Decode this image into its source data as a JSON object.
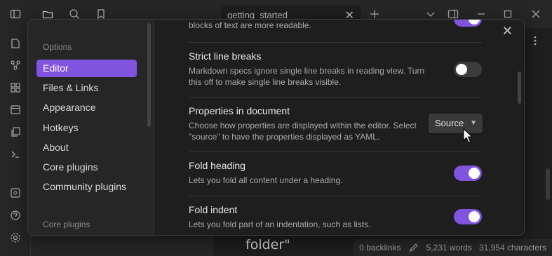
{
  "tab": {
    "title": "getting_started",
    "close": "✕"
  },
  "background": {
    "folder_text": "folder\""
  },
  "status": {
    "backlinks": "0 backlinks",
    "words": "5,231 words",
    "characters": "31,954 characters"
  },
  "modal": {
    "close": "✕",
    "sidebar": {
      "options_heading": "Options",
      "items": [
        {
          "label": "Editor",
          "active": true
        },
        {
          "label": "Files & Links"
        },
        {
          "label": "Appearance"
        },
        {
          "label": "Hotkeys"
        },
        {
          "label": "About"
        },
        {
          "label": "Core plugins"
        },
        {
          "label": "Community plugins"
        }
      ],
      "core_plugins_heading": "Core plugins"
    },
    "settings": {
      "top_desc": "blocks of text are more readable.",
      "strict": {
        "name": "Strict line breaks",
        "desc": "Markdown specs ignore single line breaks in reading view. Turn this off to make single line breaks visible.",
        "toggle": false
      },
      "properties": {
        "name": "Properties in document",
        "desc": "Choose how properties are displayed within the editor. Select \"source\" to have the properties displayed as YAML.",
        "value": "Source"
      },
      "fold_heading": {
        "name": "Fold heading",
        "desc": "Lets you fold all content under a heading.",
        "toggle": true
      },
      "fold_indent": {
        "name": "Fold indent",
        "desc": "Lets you fold part of an indentation, such as lists.",
        "toggle": true
      }
    }
  },
  "colors": {
    "accent": "#8154e0",
    "background": "#1e1e1e",
    "panel": "#262626"
  }
}
